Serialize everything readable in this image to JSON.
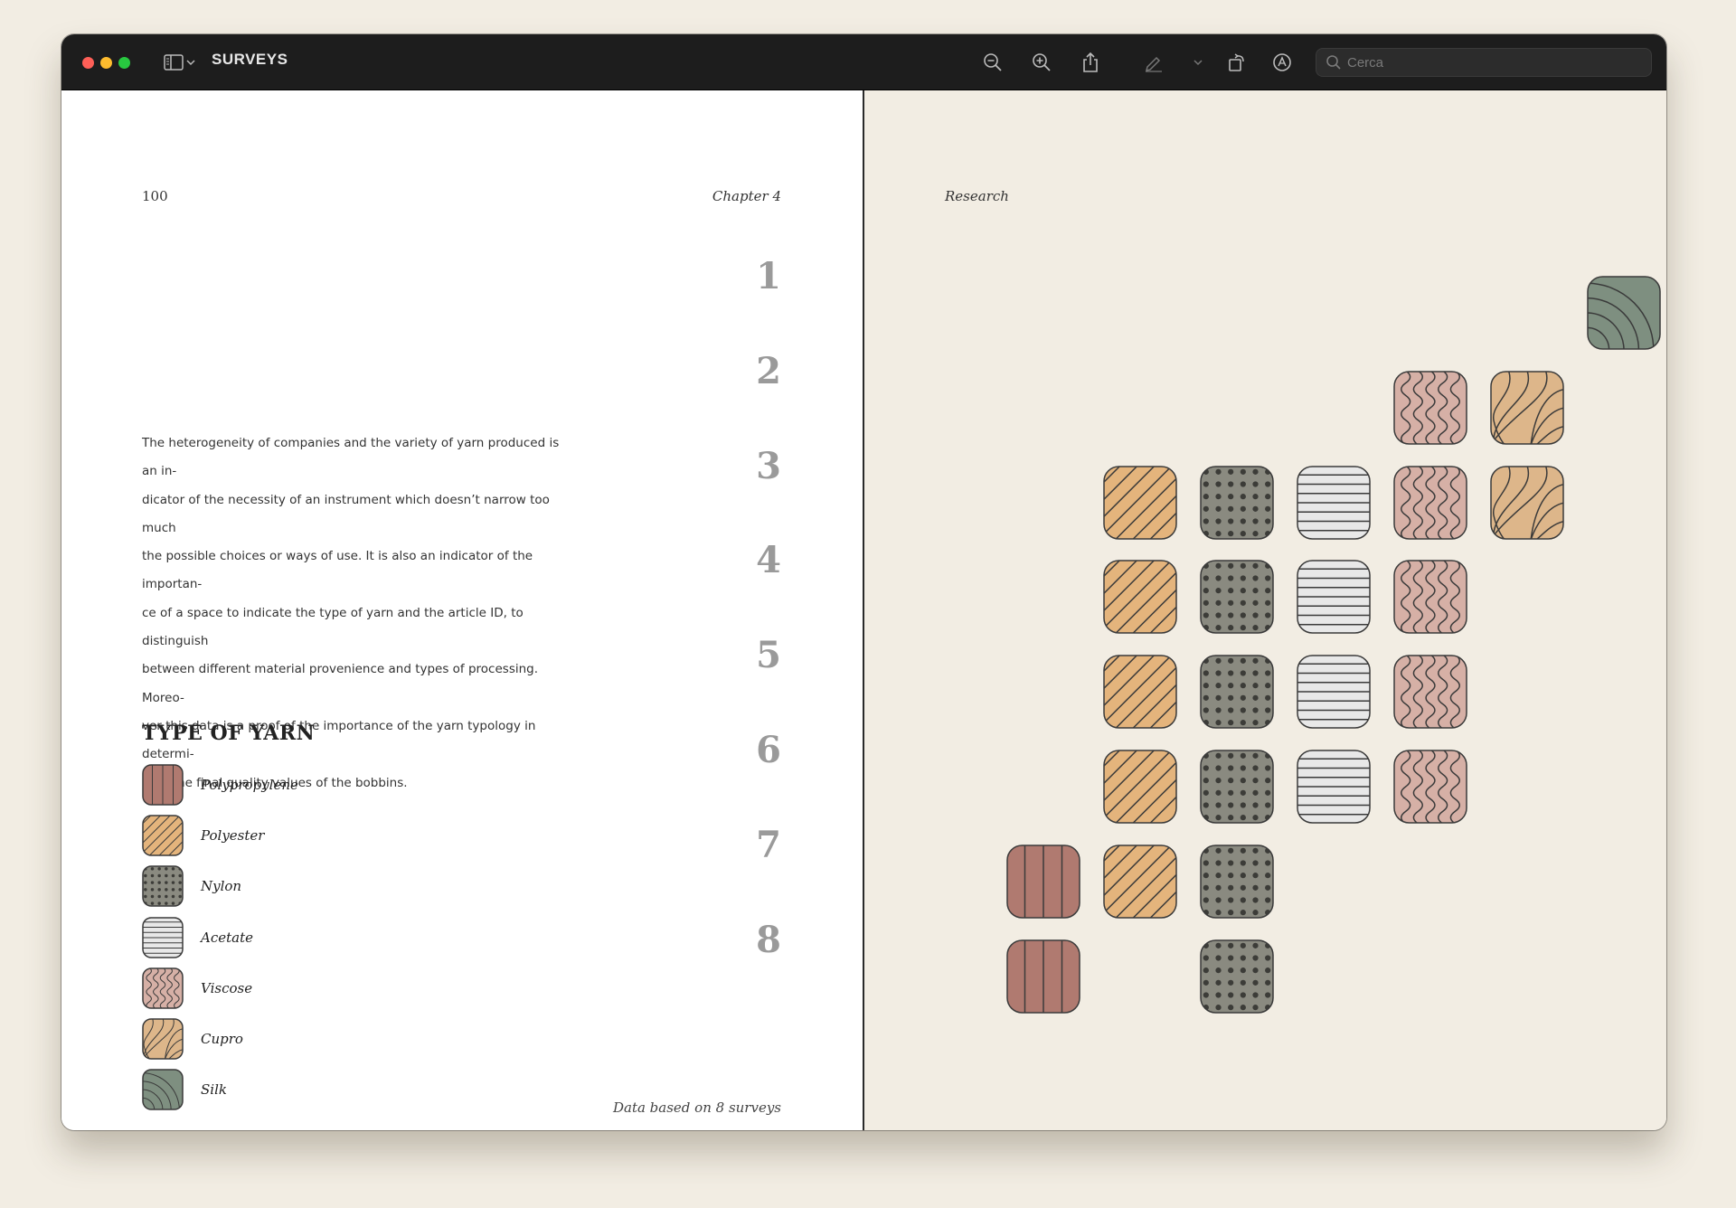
{
  "window": {
    "title": "SURVEYS",
    "search_placeholder": "Cerca"
  },
  "toolbar": {
    "icons": [
      "sidebar-icon",
      "chevron-down-icon",
      "zoom-out-icon",
      "zoom-in-icon",
      "share-icon",
      "highlight-pen-icon",
      "chevron-down-icon",
      "rotate-icon",
      "markup-icon",
      "search-icon"
    ]
  },
  "left_page": {
    "page_number": "100",
    "chapter": "Chapter 4",
    "survey_numbers": [
      "1",
      "2",
      "3",
      "4",
      "5",
      "6",
      "7",
      "8"
    ],
    "body_lines": [
      "The heterogeneity of companies and the variety of yarn produced is an in-",
      "dicator of the necessity of an instrument which doesn’t narrow too much",
      "the possible choices or ways of use. It is also an indicator of the importan-",
      "ce of a space to indicate the type of yarn and the article ID, to distinguish",
      "between different material provenience and types of processing. Moreo-",
      "ver this data is a proof of the importance of the yarn typology in determi-",
      "ning the final quality values of the bobbins."
    ],
    "legend_title": "TYPE OF YARN",
    "legend": [
      {
        "key": "polypropylene",
        "label": "Polypropylene",
        "color": "#b07a70"
      },
      {
        "key": "polyester",
        "label": "Polyester",
        "color": "#e4b47c"
      },
      {
        "key": "nylon",
        "label": "Nylon",
        "color": "#8a8a80"
      },
      {
        "key": "acetate",
        "label": "Acetate",
        "color": "#e8e8e8"
      },
      {
        "key": "viscose",
        "label": "Viscose",
        "color": "#d6b0a6"
      },
      {
        "key": "cupro",
        "label": "Cupro",
        "color": "#ddb68a"
      },
      {
        "key": "silk",
        "label": "Silk",
        "color": "#7e8f80"
      }
    ],
    "footnote": "Data based on 8 surveys"
  },
  "right_page": {
    "header": "Research"
  },
  "chart_data": {
    "type": "table",
    "rows": [
      "1",
      "2",
      "3",
      "4",
      "5",
      "6",
      "7",
      "8"
    ],
    "columns": [
      "Polypropylene",
      "Polyester",
      "Nylon",
      "Acetate",
      "Viscose",
      "Cupro",
      "Silk"
    ],
    "surveys": [
      {
        "survey": "1",
        "yarns": [
          "Silk"
        ]
      },
      {
        "survey": "2",
        "yarns": [
          "Viscose",
          "Cupro"
        ]
      },
      {
        "survey": "3",
        "yarns": [
          "Polyester",
          "Nylon",
          "Acetate",
          "Viscose",
          "Cupro"
        ]
      },
      {
        "survey": "4",
        "yarns": [
          "Polyester",
          "Nylon",
          "Acetate",
          "Viscose"
        ]
      },
      {
        "survey": "5",
        "yarns": [
          "Polyester",
          "Nylon",
          "Acetate",
          "Viscose"
        ]
      },
      {
        "survey": "6",
        "yarns": [
          "Polyester",
          "Nylon",
          "Acetate",
          "Viscose"
        ]
      },
      {
        "survey": "7",
        "yarns": [
          "Polypropylene",
          "Polyester",
          "Nylon"
        ]
      },
      {
        "survey": "8",
        "yarns": [
          "Polypropylene",
          "Nylon"
        ]
      }
    ]
  }
}
